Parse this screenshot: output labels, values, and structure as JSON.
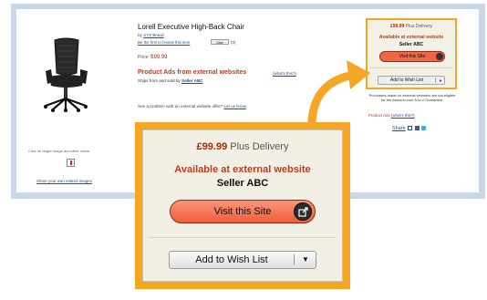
{
  "product": {
    "title": "Lorell Executive High-Back Chair",
    "by_prefix": "by",
    "brand": "XYZ Brand",
    "review_link": "Be the first to review this item",
    "like_label": "Like",
    "like_count": "(0)",
    "price_label": "Price:",
    "price": "$99.99",
    "product_ads_heading": "Product Ads from external websites",
    "whats_this": "(what's this?)",
    "ships_text": "Ships from and sold by",
    "seller": "Seller ABC",
    "problem_text": "See a problem with an external website offer?",
    "let_us_know": "Let us know"
  },
  "images": {
    "larger_caption": "Click for larger image and other views",
    "share_own_images": "Share your own related images"
  },
  "small_box": {
    "price": "£99.99",
    "delivery": "Plus Delivery",
    "availability": "Available at external website",
    "seller": "Seller ABC",
    "visit_label": "Visit this Site",
    "wishlist_label": "Add to Wish List",
    "disclaimer": "Purchases made on external websites are not eligible for the Amazon.com A-to-z Guarantee.",
    "product_ads_label": "Product Ads",
    "whats_this": "(what's this?)",
    "share_label": "Share"
  },
  "zoom_box": {
    "price": "£99.99",
    "delivery": "Plus Delivery",
    "availability": "Available at external website",
    "seller": "Seller ABC",
    "visit_label": "Visit this Site",
    "wishlist_label": "Add to Wish List"
  },
  "colors": {
    "highlight": "#f5a623",
    "price": "#b12704",
    "availability": "#c4391a",
    "link": "#1a4f9c",
    "visit_button": "#ef6644"
  },
  "icons": [
    "chair-image",
    "external-link-icon",
    "dropdown-arrow-icon",
    "email-icon",
    "facebook-icon",
    "twitter-icon",
    "callout-arrow"
  ]
}
